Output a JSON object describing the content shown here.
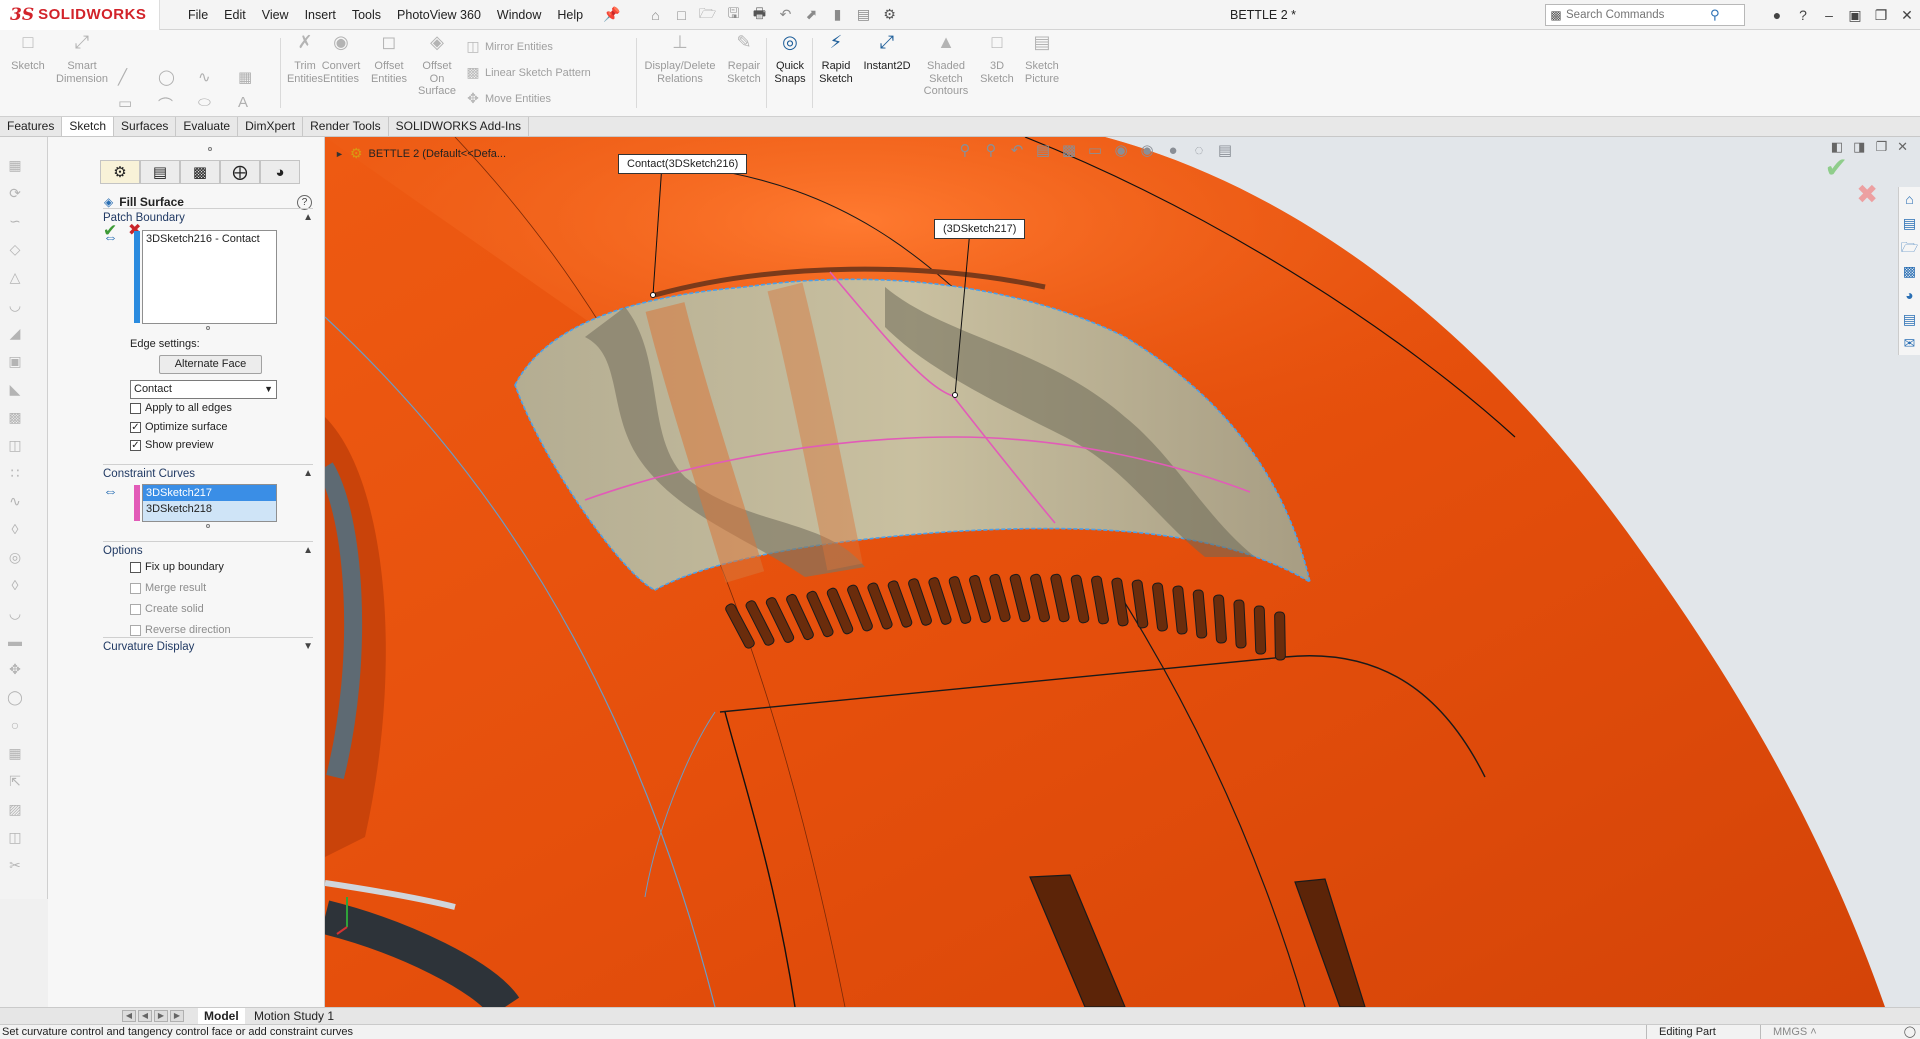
{
  "app": {
    "logo_ds": "3S",
    "logo_text": "SOLIDWORKS",
    "document_title": "BETTLE 2 *",
    "menu": [
      "File",
      "Edit",
      "View",
      "Insert",
      "Tools",
      "PhotoView 360",
      "Window",
      "Help"
    ],
    "search_placeholder": "Search Commands"
  },
  "toolbar": {
    "sketch": "Sketch",
    "smart_dimension_1": "Smart",
    "smart_dimension_2": "Dimension",
    "trim_1": "Trim",
    "trim_2": "Entities",
    "convert_1": "Convert",
    "convert_2": "Entities",
    "offset_1": "Offset",
    "offset_2": "Entities",
    "offset_surface_1": "Offset",
    "offset_surface_2": "On",
    "offset_surface_3": "Surface",
    "mirror": "Mirror Entities",
    "linear_pattern": "Linear Sketch Pattern",
    "move": "Move Entities",
    "display_delete_1": "Display/Delete",
    "display_delete_2": "Relations",
    "repair_1": "Repair",
    "repair_2": "Sketch",
    "quick_snaps_1": "Quick",
    "quick_snaps_2": "Snaps",
    "rapid_1": "Rapid",
    "rapid_2": "Sketch",
    "instant2d": "Instant2D",
    "shaded_1": "Shaded",
    "shaded_2": "Sketch",
    "shaded_3": "Contours",
    "sketch3d_1": "3D",
    "sketch3d_2": "Sketch",
    "picture_1": "Sketch",
    "picture_2": "Picture"
  },
  "tabs": [
    "Features",
    "Sketch",
    "Surfaces",
    "Evaluate",
    "DimXpert",
    "Render Tools",
    "SOLIDWORKS Add-Ins"
  ],
  "active_tab": "Sketch",
  "property_manager": {
    "title": "Fill Surface",
    "help": "?",
    "patch_boundary": {
      "heading": "Patch Boundary",
      "items": [
        "3DSketch216 - Contact"
      ],
      "edge_settings_label": "Edge settings:",
      "alternate_face": "Alternate Face",
      "edge_type": "Contact",
      "apply_all": "Apply to all edges",
      "optimize": "Optimize surface",
      "show_preview": "Show preview",
      "apply_all_checked": false,
      "optimize_checked": true,
      "show_preview_checked": true
    },
    "constraint_curves": {
      "heading": "Constraint Curves",
      "items": [
        "3DSketch217",
        "3DSketch218"
      ]
    },
    "options": {
      "heading": "Options",
      "fix_up": "Fix up boundary",
      "merge": "Merge result",
      "create_solid": "Create solid",
      "reverse": "Reverse direction"
    },
    "curvature_display": {
      "heading": "Curvature Display"
    }
  },
  "viewport": {
    "tree_label": "BETTLE 2  (Default<<Defa...",
    "callout_1": "Contact(3DSketch216)",
    "callout_2": "(3DSketch217)"
  },
  "bottom": {
    "model_tab": "Model",
    "motion_tab": "Motion Study 1"
  },
  "status": {
    "message": "Set curvature control and tangency control face or add constraint curves",
    "mode": "Editing Part",
    "units": "MMGS  ˄"
  },
  "colors": {
    "body_orange": "#e8560f",
    "sketch_pink": "#e25bb8",
    "selection_blue": "#3a8ee6",
    "brand_red": "#d2232a"
  }
}
